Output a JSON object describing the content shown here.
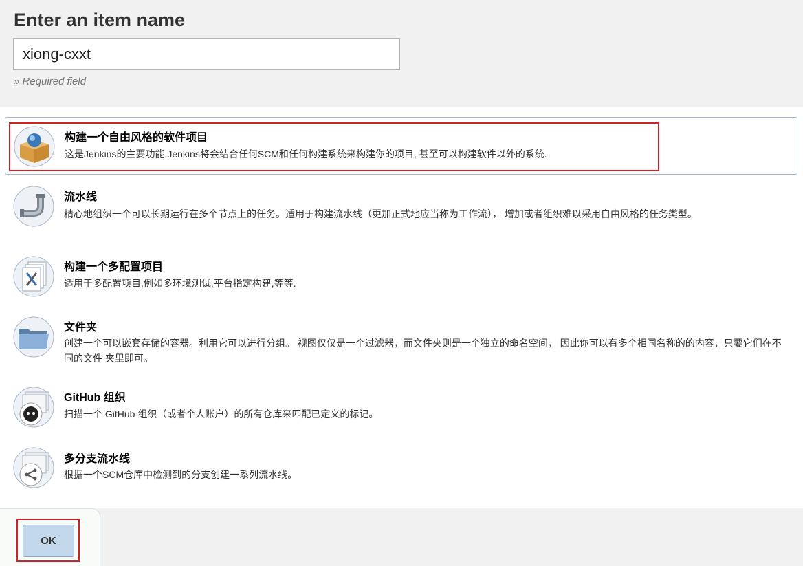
{
  "page": {
    "title": "Enter an item name"
  },
  "name_input": {
    "value": "xiong-cxxt",
    "hint": "» Required field"
  },
  "items": [
    {
      "title": "构建一个自由风格的软件项目",
      "description": "这是Jenkins的主要功能.Jenkins将会结合任何SCM和任何构建系统来构建你的项目, 甚至可以构建软件以外的系统.",
      "icon": "freestyle-box-icon"
    },
    {
      "title": "流水线",
      "description": "精心地组织一个可以长期运行在多个节点上的任务。适用于构建流水线（更加正式地应当称为工作流）， 增加或者组织难以采用自由风格的任务类型。",
      "icon": "pipe-icon"
    },
    {
      "title": "构建一个多配置项目",
      "description": "适用于多配置项目,例如多环境测试,平台指定构建,等等.",
      "icon": "multi-config-icon"
    },
    {
      "title": "文件夹",
      "description": "创建一个可以嵌套存储的容器。利用它可以进行分组。 视图仅仅是一个过滤器，而文件夹则是一个独立的命名空间， 因此你可以有多个相同名称的的内容，只要它们在不同的文件 夹里即可。",
      "icon": "folder-icon"
    },
    {
      "title": "GitHub 组织",
      "description": "扫描一个 GitHub 组织（或者个人账户）的所有仓库来匹配已定义的标记。",
      "icon": "github-org-icon"
    },
    {
      "title": "多分支流水线",
      "description": "根据一个SCM仓库中检测到的分支创建一系列流水线。",
      "icon": "multibranch-icon"
    }
  ],
  "footer": {
    "ok_label": "OK"
  },
  "colors": {
    "highlight": "#d0222c",
    "selected_border": "#9fb7d2",
    "ok_bg": "#c4d8ec"
  }
}
